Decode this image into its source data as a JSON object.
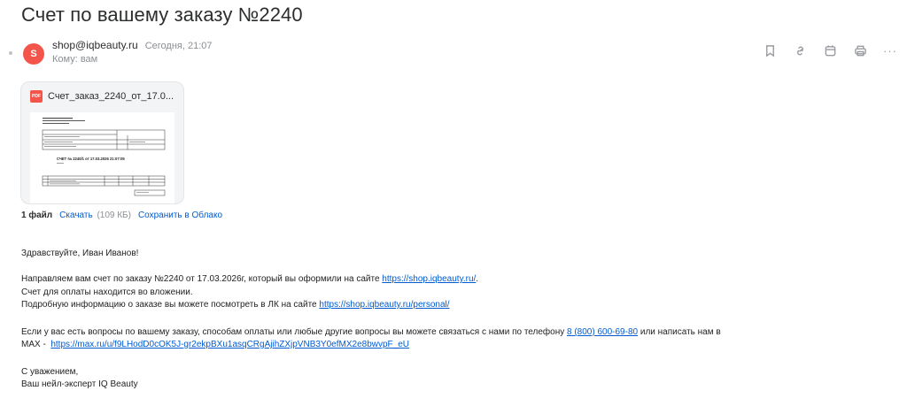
{
  "email": {
    "subject": "Счет по вашему заказу №2240",
    "sender": {
      "avatar_letter": "S",
      "avatar_color": "#f3554b",
      "email": "shop@iqbeauty.ru",
      "date": "Сегодня, 21:07",
      "recipient": "Кому: вам"
    },
    "toolbar": {
      "icons": [
        "bookmark-icon",
        "link-icon",
        "calendar-icon",
        "print-icon",
        "more-icon"
      ],
      "more": "···"
    },
    "attachment": {
      "type_label": "PDF",
      "filename": "Счет_заказ_2240_от_17.0...",
      "preview_title": "СЧЕТ № 2240/1 от 17.03.2026 21:07:05"
    },
    "files": {
      "count": "1 файл",
      "download": "Скачать",
      "size": "(109 КБ)",
      "save_cloud": "Сохранить в Облако"
    },
    "body": {
      "greeting": "Здравствуйте, Иван Иванов!",
      "p1_before": "Направляем вам счет по заказу №2240 от 17.03.2026г, который вы оформили на сайте ",
      "p1_link": "https://shop.iqbeauty.ru/",
      "p1_after": ".",
      "p2": "Счет для оплаты находится во вложении.",
      "p3_before": "Подробную информацию о заказе вы можете посмотреть в ЛК на сайте ",
      "p3_link": "https://shop.iqbeauty.ru/personal/",
      "p4_before": "Если у вас есть вопросы по вашему заказу, способам оплаты или любые другие вопросы вы можете связаться с нами по телефону ",
      "p4_phone": "8 (800) 600-69-80",
      "p4_after": " или написать нам в",
      "p5_before": "MAX -  ",
      "p5_link": "https://max.ru/u/f9LHodD0cOK5J-gr2ekpBXu1asqCRgAjihZXjpVNB3Y0efMX2e8bwvpF_eU",
      "signoff": "С уважением,",
      "signature": "Ваш нейл-эксперт IQ Beauty"
    }
  }
}
